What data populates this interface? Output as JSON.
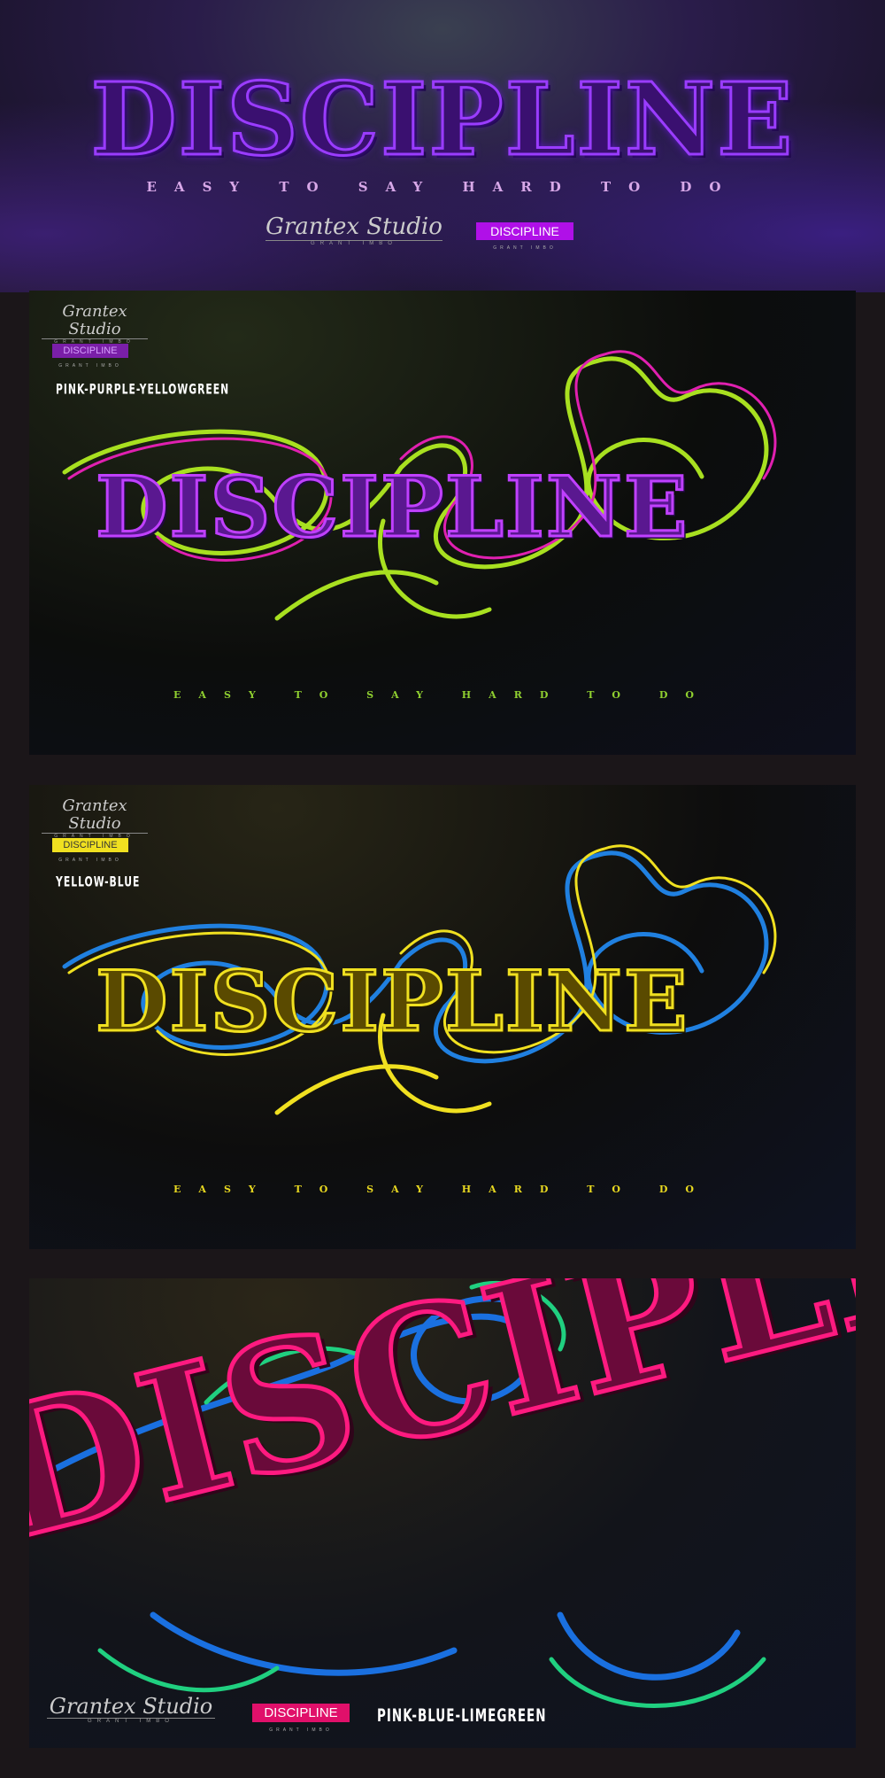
{
  "hero": {
    "title": "DISCIPLINE",
    "tagline": "EASY TO SAY HARD TO DO",
    "logo": {
      "name": "Grantex Studio",
      "sub": "GRANT IMBO"
    },
    "badge": {
      "text": "DISCIPLINE",
      "sub": "GRANT IMBO"
    }
  },
  "panels": [
    {
      "logo": {
        "name": "Grantex Studio",
        "sub": "GRANT IMBO"
      },
      "badge": {
        "text": "DISCIPLINE",
        "sub": "GRANT IMBO"
      },
      "label": "PINK-PURPLE-YELLOWGREEN",
      "title": "DISCIPLINE",
      "tagline": "EASY TO SAY HARD TO DO",
      "colors": {
        "text": "#5a1890",
        "stroke": "#c040ff",
        "tube1": "#a8e020",
        "tube2": "#e020b0",
        "badge": "#7a1fa8",
        "tag": "#90d030"
      }
    },
    {
      "logo": {
        "name": "Grantex Studio",
        "sub": "GRANT IMBO"
      },
      "badge": {
        "text": "DISCIPLINE",
        "sub": "GRANT IMBO"
      },
      "label": "YELLOW-BLUE",
      "title": "DISCIPLINE",
      "tagline": "EASY TO SAY HARD TO DO",
      "colors": {
        "text": "#5a4a00",
        "stroke": "#f0e020",
        "tube1": "#2080e0",
        "tube2": "#f0e020",
        "badge": "#f0e020",
        "tag": "#e8d820"
      }
    },
    {
      "logo": {
        "name": "Grantex Studio",
        "sub": "GRANT IMBO"
      },
      "badge": {
        "text": "DISCIPLINE",
        "sub": "GRANT IMBO"
      },
      "label": "PINK-BLUE-LIMEGREEN",
      "title": "DISCIPLINE",
      "colors": {
        "text": "#6a0a3a",
        "stroke": "#ff1a80",
        "tube1": "#1a70e0",
        "tube2": "#20d080",
        "badge": "#e0106a"
      }
    }
  ]
}
